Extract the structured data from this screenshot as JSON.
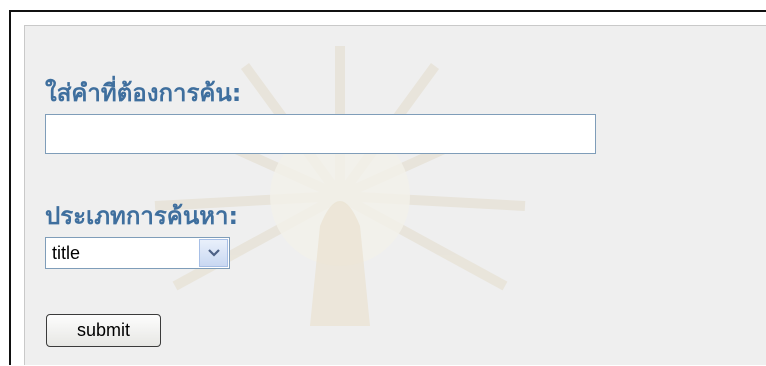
{
  "form": {
    "query_label": "ใส่คำที่ต้องการค้น:",
    "query_value": "",
    "type_label": "ประเภทการค้นหา:",
    "type_selected": "title",
    "submit_label": "submit"
  },
  "colors": {
    "label": "#3f6f9e",
    "panel_background": "#efefef",
    "input_border": "#7f9db9"
  },
  "icons": {
    "select_arrow": "chevron-down-icon",
    "watermark": "seal-watermark"
  }
}
